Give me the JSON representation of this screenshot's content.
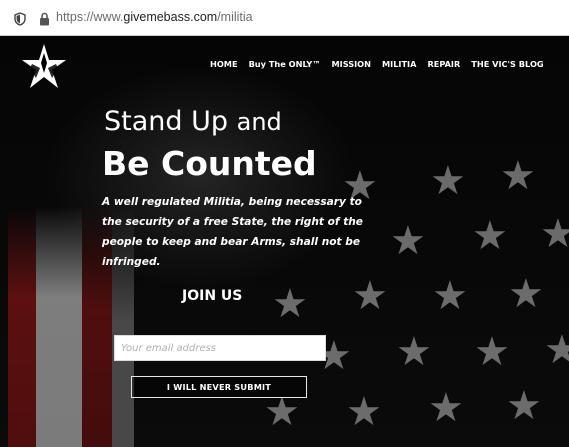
{
  "browser": {
    "url_prefix": "https://www.",
    "url_domain": "givemebass.com",
    "url_path": "/militia",
    "icons": [
      "shield-icon",
      "lock-icon"
    ]
  },
  "site": {
    "logo": "star-logo",
    "nav": [
      "HOME",
      "Buy The ONLY™",
      "MISSION",
      "MILITIA",
      "REPAIR",
      "THE VIC'S BLOG"
    ]
  },
  "hero": {
    "line1_a": "Stand Up",
    "line1_b": "and",
    "line2": "Be Counted",
    "quote": "A well regulated Militia, being necessary to the security of a free State, the right of the people to keep and bear Arms, shall not be infringed."
  },
  "signup": {
    "heading": "JOIN US",
    "email_placeholder": "Your email address",
    "email_value": "",
    "button_label": "I WILL NEVER SUBMIT"
  },
  "colors": {
    "background": "#000000",
    "text": "#ffffff",
    "flag_red": "#7a1212",
    "flag_white": "#b0b0b0"
  }
}
